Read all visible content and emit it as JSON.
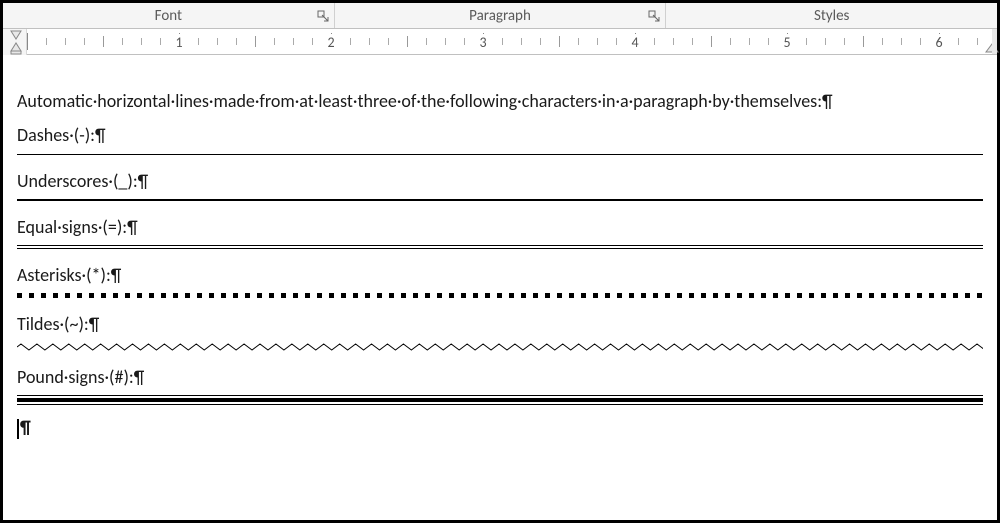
{
  "ribbon": {
    "groups": [
      {
        "label": "Font"
      },
      {
        "label": "Paragraph"
      },
      {
        "label": "Styles"
      }
    ]
  },
  "ruler": {
    "numbers": [
      "1",
      "2",
      "3",
      "4",
      "5",
      "6"
    ]
  },
  "document": {
    "intro": "Automatic·horizontal·lines·made·from·at·least·three·of·the·following·characters·in·a·paragraph·by·themselves:¶",
    "sections": [
      {
        "label": "Dashes·(-):¶",
        "line_type": "dashes"
      },
      {
        "label": "Underscores·(_):¶",
        "line_type": "underscore"
      },
      {
        "label": "Equal·signs·(=):¶",
        "line_type": "equal"
      },
      {
        "label": "Asterisks·(*):¶",
        "line_type": "asterisk"
      },
      {
        "label": "Tildes·(~):¶",
        "line_type": "tilde"
      },
      {
        "label": "Pound·signs·(#):¶",
        "line_type": "pound"
      }
    ],
    "trailing_pilcrow": "¶"
  }
}
